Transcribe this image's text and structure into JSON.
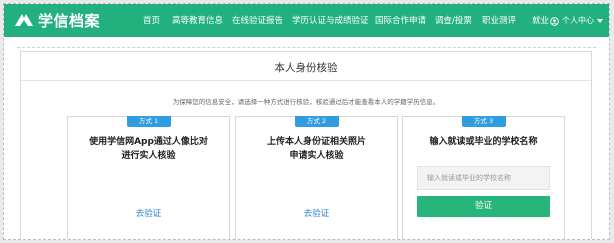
{
  "brand": {
    "name": "学信档案"
  },
  "nav": {
    "items": [
      {
        "label": "首页"
      },
      {
        "label": "高等教育信息"
      },
      {
        "label": "在线验证报告"
      },
      {
        "label": "学历认证与成绩验证"
      },
      {
        "label": "国际合作申请"
      },
      {
        "label": "调查/投票"
      },
      {
        "label": "职业测评"
      },
      {
        "label": "就业"
      }
    ],
    "user_menu": "个人中心"
  },
  "page": {
    "title": "本人身份核验",
    "subtitle": "为保障您的信息安全，请选择一种方式进行核验，核验通过后才能查看本人的学籍学历信息。"
  },
  "methods": [
    {
      "badge": "方式 1",
      "title_line1": "使用学信网App通过人像比对",
      "title_line2": "进行实人核验",
      "link": "去验证"
    },
    {
      "badge": "方式 2",
      "title_line1": "上传本人身份证相关照片",
      "title_line2": "申请实人核验",
      "link": "去验证"
    },
    {
      "badge": "方式 3",
      "title_line1": "输入就读或毕业的学校名称",
      "input_placeholder": "输入就读或毕业的学校名称",
      "button": "验证"
    }
  ],
  "colors": {
    "nav_bg": "#22b07f",
    "badge": "#2f9de0",
    "link": "#2f7fd0",
    "button": "#27b57c"
  }
}
